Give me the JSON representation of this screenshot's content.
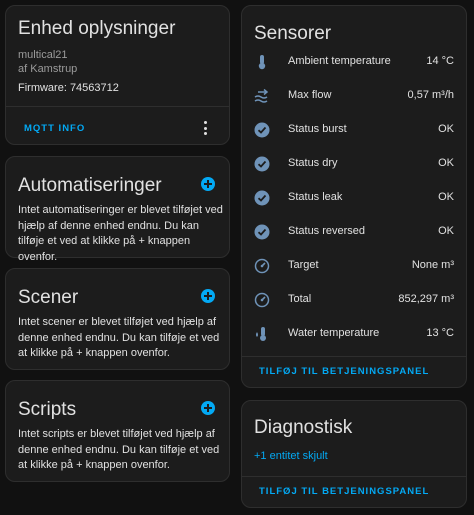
{
  "device": {
    "title": "Enhed oplysninger",
    "model": "multical21",
    "manufacturer": "af Kamstrup",
    "firmware": "Firmware: 74563712",
    "mqtt_label": "MQTT INFO"
  },
  "automations": {
    "title": "Automatiseringer",
    "text": "Intet automatiseringer er blevet tilføjet ved hjælp af denne enhed endnu. Du kan tilføje et ved at klikke på + knappen ovenfor."
  },
  "scenes": {
    "title": "Scener",
    "text": "Intet scener er blevet tilføjet ved hjælp af denne enhed endnu. Du kan tilføje et ved at klikke på + knappen ovenfor."
  },
  "scripts": {
    "title": "Scripts",
    "text": "Intet scripts er blevet tilføjet ved hjælp af denne enhed endnu. Du kan tilføje et ved at klikke på + knappen ovenfor."
  },
  "sensors": {
    "title": "Sensorer",
    "items": [
      {
        "icon": "thermometer-icon",
        "label": "Ambient temperature",
        "value": "14 °C"
      },
      {
        "icon": "waves-arrow-icon",
        "label": "Max flow",
        "value": "0,57 m³/h"
      },
      {
        "icon": "check-circle-icon",
        "label": "Status burst",
        "value": "OK"
      },
      {
        "icon": "check-circle-icon",
        "label": "Status dry",
        "value": "OK"
      },
      {
        "icon": "check-circle-icon",
        "label": "Status leak",
        "value": "OK"
      },
      {
        "icon": "check-circle-icon",
        "label": "Status reversed",
        "value": "OK"
      },
      {
        "icon": "gauge-icon",
        "label": "Target",
        "value": "None m³"
      },
      {
        "icon": "gauge-icon",
        "label": "Total",
        "value": "852,297 m³"
      },
      {
        "icon": "thermometer-water-icon",
        "label": "Water temperature",
        "value": "13 °C"
      }
    ],
    "add_button": "TILFØJ TIL BETJENINGSPANEL"
  },
  "diagnostics": {
    "title": "Diagnostisk",
    "hidden_link": "+1 entitet skjult",
    "add_button": "TILFØJ TIL BETJENINGSPANEL"
  },
  "colors": {
    "background": "#111111",
    "card": "#1c1c1c",
    "accent": "#03a9f4",
    "icon": "#6f93b8"
  }
}
